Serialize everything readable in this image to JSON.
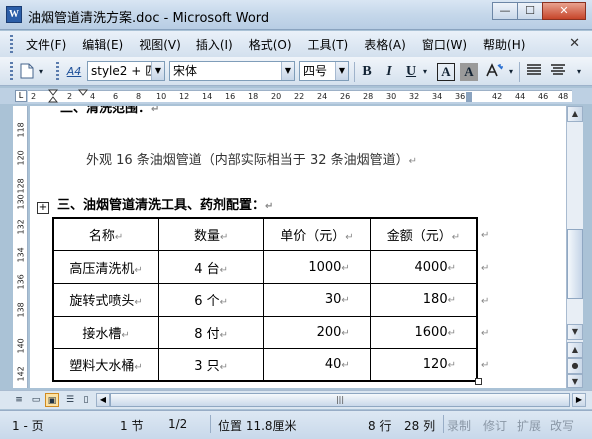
{
  "window": {
    "app_icon_letter": "W",
    "title": "油烟管道清洗方案.doc - Microsoft Word",
    "buttons": [
      "—",
      "☐",
      "✕"
    ]
  },
  "menubar": {
    "items": [
      "文件(F)",
      "编辑(E)",
      "视图(V)",
      "插入(I)",
      "格式(O)",
      "工具(T)",
      "表格(A)",
      "窗口(W)",
      "帮助(H)"
    ],
    "close_glyph": "✕"
  },
  "toolbar": {
    "style_combo": "style2 + 匹",
    "font_combo": "宋体",
    "size_combo": "四号",
    "bold": "B",
    "italic": "I",
    "underline": "U",
    "char_border": "A",
    "char_shading": "A",
    "styles_label": "A4",
    "icon_names": [
      "new-doc-icon",
      "styles-pane-icon",
      "font-color-icon",
      "align-left-icon",
      "align-center-icon"
    ]
  },
  "ruler": {
    "corner_glyph": "L",
    "numbers": [
      "2",
      "2",
      "4",
      "6",
      "8",
      "10",
      "12",
      "14",
      "16",
      "18",
      "20",
      "22",
      "24",
      "26",
      "28",
      "30",
      "32",
      "34",
      "36",
      "38",
      "",
      "42",
      "44",
      "46",
      "48"
    ]
  },
  "vruler": {
    "numbers": [
      "118",
      "120",
      "128",
      "130",
      "132",
      "134",
      "136",
      "138",
      "140",
      "142"
    ]
  },
  "document": {
    "heading2_partial": "二、清洗范围：",
    "body_line": "外观 16 条油烟管道（内部实际相当于 32 条油烟管道）",
    "heading3": "三、油烟管道清洗工具、药剂配置：",
    "mark": "↵",
    "table": {
      "headers": [
        "名称",
        "数量",
        "单价（元）",
        "金额（元）"
      ],
      "rows": [
        [
          "高压清洗机",
          "4 台",
          "1000",
          "4000"
        ],
        [
          "旋转式喷头",
          "6 个",
          "30",
          "180"
        ],
        [
          "接水槽",
          "8 付",
          "200",
          "1600"
        ],
        [
          "塑料大水桶",
          "3 只",
          "40",
          "120"
        ]
      ]
    }
  },
  "statusbar": {
    "page": "1 - 页",
    "section": "1 节",
    "page_of": "1/2",
    "position": "位置 11.8厘米",
    "line": "8 行",
    "column": "28 列",
    "rec": "录制",
    "trk": "修订",
    "ext": "扩展",
    "ovr": "改写"
  },
  "colors": {
    "frame": "#aac2d6",
    "titlebar": "#c5d7ea",
    "close_button": "#c6452a",
    "page": "#ffffff"
  }
}
